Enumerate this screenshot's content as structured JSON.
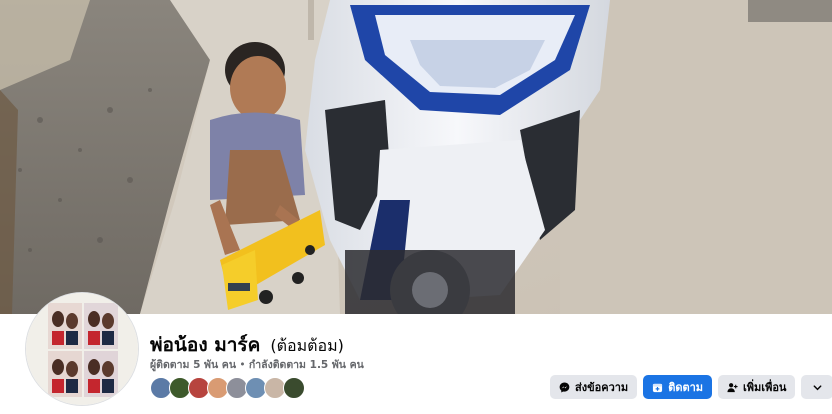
{
  "profile": {
    "name": "พ่อน้อง มาร์ค",
    "alternate_name": "(ต้อมต้อม)",
    "followers_text": "ผู้ติดตาม 5 พัน คน",
    "separator": "•",
    "following_text": "กำลังติดตาม 1.5 พัน คน"
  },
  "actions": {
    "message_label": "ส่งข้อความ",
    "follow_label": "ติดตาม",
    "add_friend_label": "เพิ่มเพื่อน"
  },
  "friend_avatars": [
    "friend-1",
    "friend-2",
    "friend-3",
    "friend-4",
    "friend-5",
    "friend-6",
    "friend-7",
    "friend-8"
  ],
  "colors": {
    "primary": "#1b74e4",
    "button_grey": "#e4e6eb",
    "text_primary": "#050505",
    "text_secondary": "#65676b"
  },
  "icons": {
    "message": "messenger-icon",
    "follow": "follow-icon",
    "add_friend": "add-friend-icon",
    "more": "chevron-down-icon"
  }
}
